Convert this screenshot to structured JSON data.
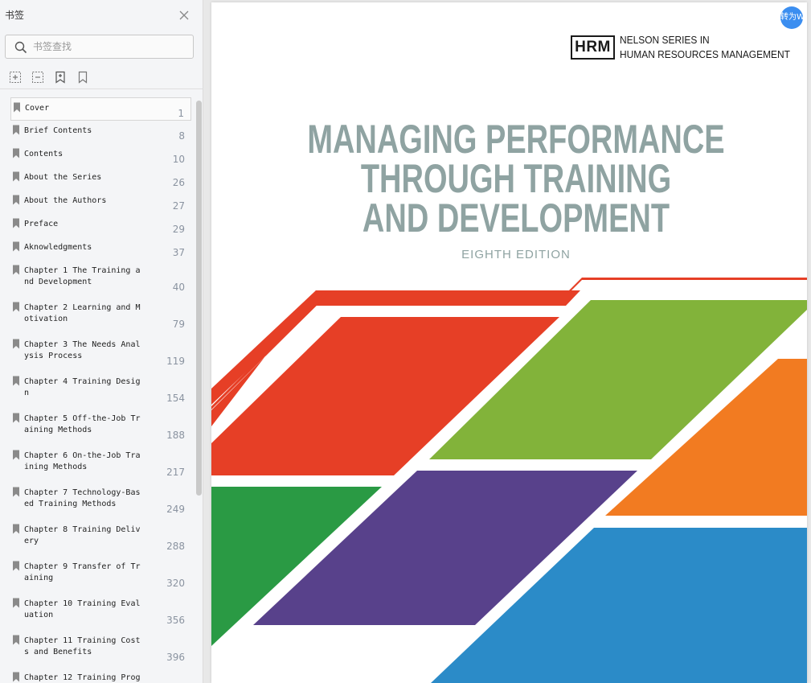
{
  "sidebar": {
    "title": "书签",
    "search_placeholder": "书签查找",
    "tools": [
      "expand-all-icon",
      "collapse-all-icon",
      "add-bookmark-icon",
      "bookmark-icon"
    ],
    "bookmarks": [
      {
        "label": "Cover",
        "page": "1"
      },
      {
        "label": "Brief Contents",
        "page": "8"
      },
      {
        "label": "Contents",
        "page": "10"
      },
      {
        "label": "About the Series",
        "page": "26"
      },
      {
        "label": "About the Authors",
        "page": "27"
      },
      {
        "label": "Preface",
        "page": "29"
      },
      {
        "label": "Aknowledgments",
        "page": "37"
      },
      {
        "label": "Chapter 1 The Training and Development",
        "page": "40"
      },
      {
        "label": "Chapter 2 Learning and Motivation",
        "page": "79"
      },
      {
        "label": "Chapter 3 The Needs Analysis Process",
        "page": "119"
      },
      {
        "label": "Chapter 4 Training Design",
        "page": "154"
      },
      {
        "label": "Chapter 5 Off-the-Job Training Methods",
        "page": "188"
      },
      {
        "label": "Chapter 6 On-the-Job Training Methods",
        "page": "217"
      },
      {
        "label": "Chapter 7 Technology-Based Training Methods",
        "page": "249"
      },
      {
        "label": "Chapter 8 Training Delivery",
        "page": "288"
      },
      {
        "label": "Chapter 9 Transfer of Training",
        "page": "320"
      },
      {
        "label": "Chapter 10 Training Evaluation",
        "page": "356"
      },
      {
        "label": "Chapter 11 Training Costs and Benefits",
        "page": "396"
      },
      {
        "label": "Chapter 12 Training Prog",
        "page": ""
      }
    ]
  },
  "cover": {
    "hrm_logo": "HRM",
    "series_line1": "NELSON SERIES IN",
    "series_line2": "HUMAN RESOURCES MANAGEMENT",
    "title_line1": "MANAGING PERFORMANCE",
    "title_line2": "THROUGH TRAINING",
    "title_line3": "AND DEVELOPMENT",
    "edition": "EIGHTH EDITION",
    "colors": {
      "title": "#8fa3a2",
      "red": "#e63f26",
      "green_light": "#82b33a",
      "orange": "#f27b21",
      "green_dark": "#2a9a44",
      "purple": "#58418b",
      "blue": "#2b8bc8"
    }
  },
  "convert_button": {
    "label": "转为W"
  }
}
